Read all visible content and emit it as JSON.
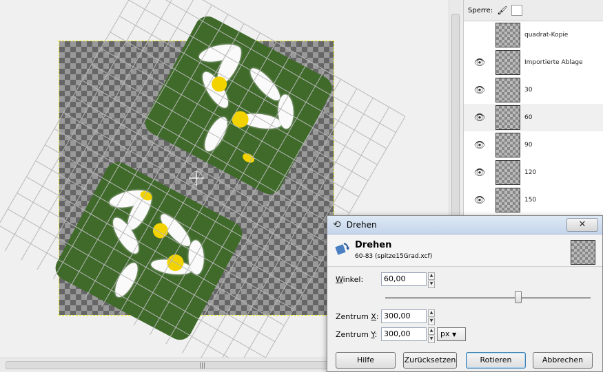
{
  "layers_panel": {
    "lock_label": "Sperre:",
    "layers": [
      {
        "name": "quadrat-Kopie",
        "visible": false,
        "selected": false
      },
      {
        "name": "Importierte Ablage",
        "visible": true,
        "selected": false
      },
      {
        "name": "30",
        "visible": true,
        "selected": false
      },
      {
        "name": "60",
        "visible": true,
        "selected": true
      },
      {
        "name": "90",
        "visible": true,
        "selected": false
      },
      {
        "name": "120",
        "visible": true,
        "selected": false
      },
      {
        "name": "150",
        "visible": true,
        "selected": false
      }
    ]
  },
  "dialog": {
    "window_title": "Drehen",
    "heading": "Drehen",
    "subtitle": "60-83 (spitze15Grad.xcf)",
    "angle_label": "Winkel:",
    "angle_value": "60,00",
    "center_x_label": "Zentrum X:",
    "center_x_value": "300,00",
    "center_y_label": "Zentrum Y:",
    "center_y_value": "300,00",
    "unit": "px",
    "buttons": {
      "help": "Hilfe",
      "reset": "Zurücksetzen",
      "rotate": "Rotieren",
      "cancel": "Abbrechen"
    },
    "close_glyph": "✕"
  },
  "colors": {
    "checker_dark": "#666666",
    "checker_light": "#999999",
    "petal": "#fafafa",
    "flower_center": "#f2d300",
    "selection_outline": "#e8e800"
  }
}
